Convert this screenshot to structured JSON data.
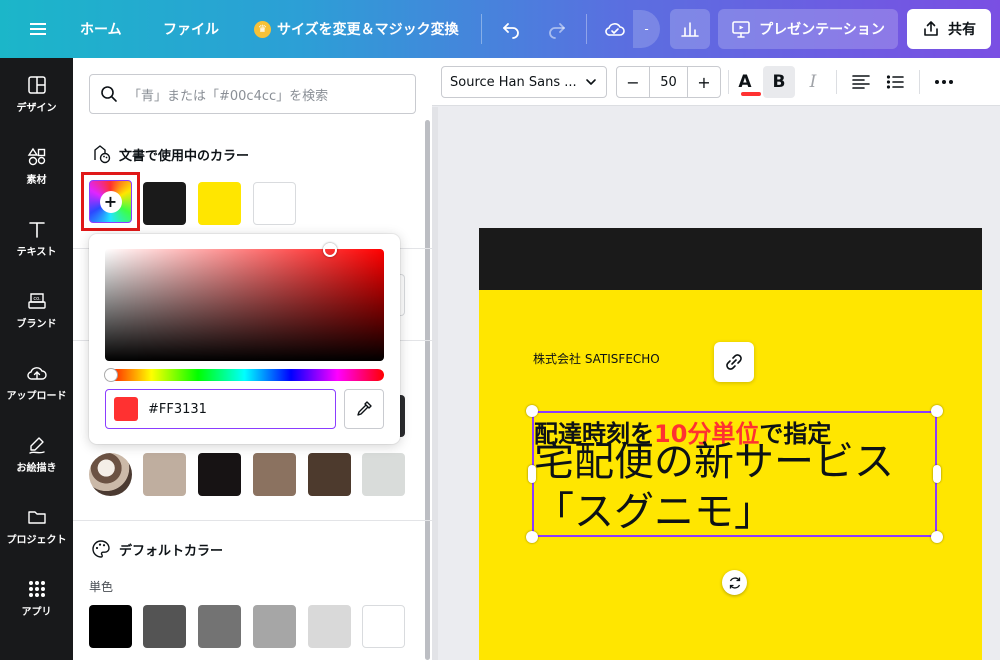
{
  "topbar": {
    "home": "ホーム",
    "file": "ファイル",
    "resize": "サイズを変更＆マジック変換",
    "dash": "-",
    "present": "プレゼンテーション",
    "share": "共有"
  },
  "rail": {
    "items": [
      {
        "label": "デザイン",
        "icon": "layout-icon"
      },
      {
        "label": "素材",
        "icon": "elements-icon"
      },
      {
        "label": "テキスト",
        "icon": "text-icon"
      },
      {
        "label": "ブランド",
        "icon": "brand-icon"
      },
      {
        "label": "アップロード",
        "icon": "upload-icon"
      },
      {
        "label": "お絵描き",
        "icon": "draw-icon"
      },
      {
        "label": "プロジェクト",
        "icon": "folder-icon"
      },
      {
        "label": "アプリ",
        "icon": "apps-icon"
      }
    ]
  },
  "panel": {
    "search_placeholder": "「青」または「#00c4cc」を検索",
    "doc_colors_title": "文書で使用中のカラー",
    "doc_colors": [
      "#1a1a1a",
      "#ffe600",
      "#ffffff"
    ],
    "photo_colors": [
      "#bfae9f",
      "#171314",
      "#8b7260",
      "#4d3a2d",
      "#d9dcda"
    ],
    "default_colors_title": "デフォルトカラー",
    "solid_label": "単色",
    "solid_colors": [
      "#000000",
      "#545454",
      "#737373",
      "#a6a6a6",
      "#d9d9d9",
      "#ffffff"
    ]
  },
  "picker": {
    "hex": "#FF3131",
    "color": "#ff3131"
  },
  "toolbar": {
    "font": "Source Han Sans ...",
    "size": "50",
    "minus": "−",
    "plus": "+",
    "text_color_glyph": "A",
    "bold_glyph": "B",
    "italic_glyph": "I",
    "text_color": "#ff3131"
  },
  "canvas": {
    "company": "株式会社 SATISFECHO",
    "line1_a": "配達時刻を",
    "line1_hl": "10分単位",
    "line1_b": "で指定",
    "line2": "宅配便の新サービス",
    "line3": "「スグニモ」"
  }
}
